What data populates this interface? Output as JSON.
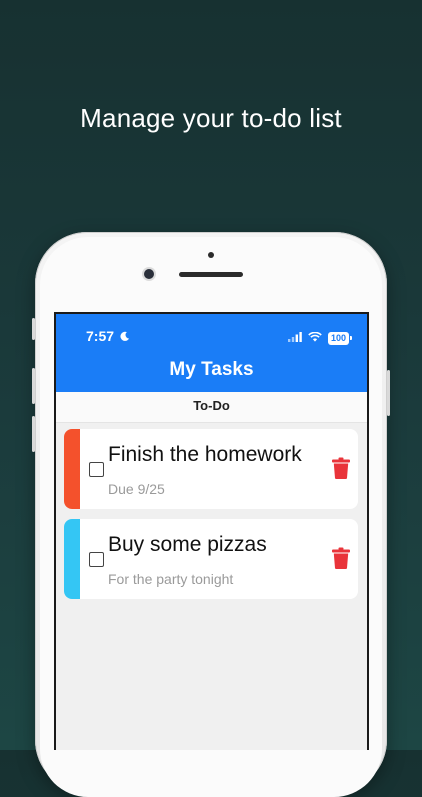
{
  "headline": "Manage your to-do list",
  "status_bar": {
    "time": "7:57",
    "battery": "100"
  },
  "app": {
    "title": "My Tasks",
    "tab": "To-Do",
    "tasks": [
      {
        "title": "Finish the homework",
        "subtitle": "Due 9/25",
        "color": "#f4512c"
      },
      {
        "title": "Buy some pizzas",
        "subtitle": "For the party tonight",
        "color": "#34c6f4"
      }
    ]
  },
  "colors": {
    "accent": "#1a7df7",
    "delete": "#e9343a"
  },
  "icons": [
    "moon-icon",
    "signal-icon",
    "wifi-icon",
    "battery-icon",
    "checkbox-icon",
    "trash-icon"
  ]
}
